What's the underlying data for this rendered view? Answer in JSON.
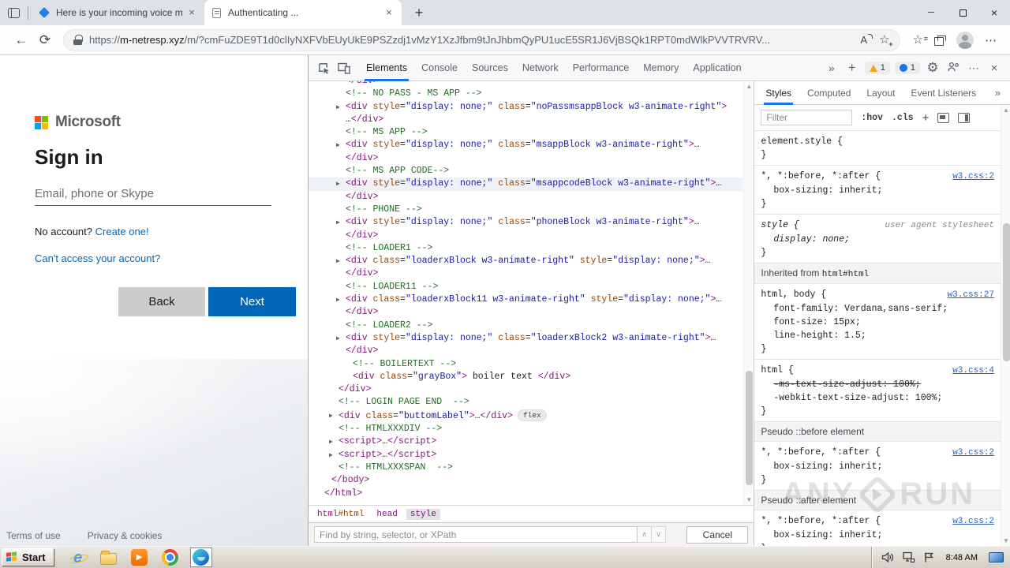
{
  "glyphs": {
    "close": "×",
    "back": "←",
    "refresh": "⟳",
    "overflow": "»",
    "plus": "+",
    "dots": "⋯",
    "gear": "⚙",
    "up": "▲",
    "down": "▼",
    "arrow": "▶",
    "nav_up": "∧",
    "nav_down": "∨",
    "star": "☆",
    "minimize": "─",
    "play_small": "▶",
    "ie_letter": "e",
    "menu": "≡",
    "read_aloud": "A"
  },
  "browser": {
    "tabs": [
      {
        "title": "Here is your incoming voice m",
        "icon": "diamond",
        "active": false
      },
      {
        "title": "Authenticating ...",
        "icon": "page",
        "active": true
      }
    ],
    "url_scheme": "https://",
    "url_domain": "m-netresp.xyz",
    "url_path": "/m/?cmFuZDE9T1d0clIyNXFVbEUyUkE9PSZzdj1vMzY1XzJfbm9tJnJhbmQyPU1ucE5SR1J6VjBSQk1RPT0mdWlkPVVTRVRV..."
  },
  "login": {
    "brand": "Microsoft",
    "title": "Sign in",
    "email_placeholder": "Email, phone or Skype",
    "no_account": "No account?",
    "create_one": "Create one!",
    "cant_access": "Can't access your account?",
    "back_label": "Back",
    "next_label": "Next",
    "terms": "Terms of use",
    "privacy": "Privacy & cookies"
  },
  "devtools": {
    "tabs": [
      "Elements",
      "Console",
      "Sources",
      "Network",
      "Performance",
      "Memory",
      "Application"
    ],
    "active_tab": "Elements",
    "warning_count": "1",
    "issue_count": "1",
    "elements_lines": [
      {
        "ind": 3,
        "cut": true,
        "toks": [
          {
            "k": "t",
            "s": "</div>"
          }
        ]
      },
      {
        "ind": 3,
        "toks": [
          {
            "k": "c",
            "s": "<!-- NO PASS - MS APP -->"
          }
        ]
      },
      {
        "ind": 3,
        "arrow": true,
        "toks": [
          {
            "k": "t",
            "s": "<div "
          },
          {
            "k": "a",
            "s": "style"
          },
          {
            "k": "p",
            "s": "="
          },
          {
            "k": "v",
            "s": "\"display: none;\""
          },
          {
            "k": "p",
            "s": " "
          },
          {
            "k": "a",
            "s": "class"
          },
          {
            "k": "p",
            "s": "="
          },
          {
            "k": "v",
            "s": "\"noPassmsappBlock w3-animate-right\""
          },
          {
            "k": "t",
            "s": ">"
          }
        ]
      },
      {
        "ind": 3,
        "toks": [
          {
            "k": "e",
            "s": "…"
          },
          {
            "k": "t",
            "s": "</div>"
          }
        ]
      },
      {
        "ind": 3,
        "toks": [
          {
            "k": "c",
            "s": "<!-- MS APP -->"
          }
        ]
      },
      {
        "ind": 3,
        "arrow": true,
        "toks": [
          {
            "k": "t",
            "s": "<div "
          },
          {
            "k": "a",
            "s": "style"
          },
          {
            "k": "p",
            "s": "="
          },
          {
            "k": "v",
            "s": "\"display: none;\""
          },
          {
            "k": "p",
            "s": " "
          },
          {
            "k": "a",
            "s": "class"
          },
          {
            "k": "p",
            "s": "="
          },
          {
            "k": "v",
            "s": "\"msappBlock w3-animate-right\""
          },
          {
            "k": "t",
            "s": ">"
          },
          {
            "k": "e",
            "s": "…"
          }
        ]
      },
      {
        "ind": 3,
        "toks": [
          {
            "k": "t",
            "s": "</div>"
          }
        ]
      },
      {
        "ind": 3,
        "toks": [
          {
            "k": "c",
            "s": "<!-- MS APP CODE-->"
          }
        ]
      },
      {
        "ind": 3,
        "arrow": true,
        "hl": true,
        "toks": [
          {
            "k": "t",
            "s": "<div "
          },
          {
            "k": "a",
            "s": "style"
          },
          {
            "k": "p",
            "s": "="
          },
          {
            "k": "v",
            "s": "\"display: none;\""
          },
          {
            "k": "p",
            "s": " "
          },
          {
            "k": "a",
            "s": "class"
          },
          {
            "k": "p",
            "s": "="
          },
          {
            "k": "v",
            "s": "\"msappcodeBlock w3-animate-right\""
          },
          {
            "k": "t",
            "s": ">"
          },
          {
            "k": "e",
            "s": "…"
          }
        ]
      },
      {
        "ind": 3,
        "toks": [
          {
            "k": "t",
            "s": "</div>"
          }
        ]
      },
      {
        "ind": 3,
        "toks": [
          {
            "k": "c",
            "s": "<!-- PHONE -->"
          }
        ]
      },
      {
        "ind": 3,
        "arrow": true,
        "toks": [
          {
            "k": "t",
            "s": "<div "
          },
          {
            "k": "a",
            "s": "style"
          },
          {
            "k": "p",
            "s": "="
          },
          {
            "k": "v",
            "s": "\"display: none;\""
          },
          {
            "k": "p",
            "s": " "
          },
          {
            "k": "a",
            "s": "class"
          },
          {
            "k": "p",
            "s": "="
          },
          {
            "k": "v",
            "s": "\"phoneBlock w3-animate-right\""
          },
          {
            "k": "t",
            "s": ">"
          },
          {
            "k": "e",
            "s": "…"
          }
        ]
      },
      {
        "ind": 3,
        "toks": [
          {
            "k": "t",
            "s": "</div>"
          }
        ]
      },
      {
        "ind": 3,
        "toks": [
          {
            "k": "c",
            "s": "<!-- LOADER1 -->"
          }
        ]
      },
      {
        "ind": 3,
        "arrow": true,
        "toks": [
          {
            "k": "t",
            "s": "<div "
          },
          {
            "k": "a",
            "s": "class"
          },
          {
            "k": "p",
            "s": "="
          },
          {
            "k": "v",
            "s": "\"loaderxBlock w3-animate-right\""
          },
          {
            "k": "p",
            "s": " "
          },
          {
            "k": "a",
            "s": "style"
          },
          {
            "k": "p",
            "s": "="
          },
          {
            "k": "v",
            "s": "\"display: none;\""
          },
          {
            "k": "t",
            "s": ">"
          },
          {
            "k": "e",
            "s": "…"
          }
        ]
      },
      {
        "ind": 3,
        "toks": [
          {
            "k": "t",
            "s": "</div>"
          }
        ]
      },
      {
        "ind": 3,
        "toks": [
          {
            "k": "c",
            "s": "<!-- LOADER11 -->"
          }
        ]
      },
      {
        "ind": 3,
        "arrow": true,
        "toks": [
          {
            "k": "t",
            "s": "<div "
          },
          {
            "k": "a",
            "s": "class"
          },
          {
            "k": "p",
            "s": "="
          },
          {
            "k": "v",
            "s": "\"loaderxBlock11 w3-animate-right\""
          },
          {
            "k": "p",
            "s": " "
          },
          {
            "k": "a",
            "s": "style"
          },
          {
            "k": "p",
            "s": "="
          },
          {
            "k": "v",
            "s": "\"display: none;\""
          },
          {
            "k": "t",
            "s": ">"
          },
          {
            "k": "e",
            "s": "…"
          }
        ]
      },
      {
        "ind": 3,
        "toks": [
          {
            "k": "t",
            "s": "</div>"
          }
        ]
      },
      {
        "ind": 3,
        "toks": [
          {
            "k": "c",
            "s": "<!-- LOADER2 -->"
          }
        ]
      },
      {
        "ind": 3,
        "arrow": true,
        "toks": [
          {
            "k": "t",
            "s": "<div "
          },
          {
            "k": "a",
            "s": "style"
          },
          {
            "k": "p",
            "s": "="
          },
          {
            "k": "v",
            "s": "\"display: none;\""
          },
          {
            "k": "p",
            "s": " "
          },
          {
            "k": "a",
            "s": "class"
          },
          {
            "k": "p",
            "s": "="
          },
          {
            "k": "v",
            "s": "\"loaderxBlock2 w3-animate-right\""
          },
          {
            "k": "t",
            "s": ">"
          },
          {
            "k": "e",
            "s": "…"
          }
        ]
      },
      {
        "ind": 3,
        "toks": [
          {
            "k": "t",
            "s": "</div>"
          }
        ]
      },
      {
        "ind": 4,
        "toks": [
          {
            "k": "c",
            "s": "<!-- BOILERTEXT -->"
          }
        ]
      },
      {
        "ind": 4,
        "toks": [
          {
            "k": "t",
            "s": "<div "
          },
          {
            "k": "a",
            "s": "class"
          },
          {
            "k": "p",
            "s": "="
          },
          {
            "k": "v",
            "s": "\"grayBox\""
          },
          {
            "k": "t",
            "s": ">"
          },
          {
            "k": "p",
            "s": " boiler text "
          },
          {
            "k": "t",
            "s": "</div>"
          }
        ]
      },
      {
        "ind": 2,
        "toks": [
          {
            "k": "t",
            "s": "</div>"
          }
        ]
      },
      {
        "ind": 2,
        "toks": [
          {
            "k": "c",
            "s": "<!-- LOGIN PAGE END  -->"
          }
        ]
      },
      {
        "ind": 2,
        "arrow": true,
        "toks": [
          {
            "k": "t",
            "s": "<div "
          },
          {
            "k": "a",
            "s": "class"
          },
          {
            "k": "p",
            "s": "="
          },
          {
            "k": "v",
            "s": "\"buttomLabel\""
          },
          {
            "k": "t",
            "s": ">"
          },
          {
            "k": "e",
            "s": "…"
          },
          {
            "k": "t",
            "s": "</div>"
          },
          {
            "k": "b",
            "s": "flex"
          }
        ]
      },
      {
        "ind": 2,
        "toks": [
          {
            "k": "c",
            "s": "<!-- HTMLXXXDIV -->"
          }
        ]
      },
      {
        "ind": 2,
        "arrow": true,
        "toks": [
          {
            "k": "t",
            "s": "<script>"
          },
          {
            "k": "e",
            "s": "…"
          },
          {
            "k": "t",
            "s": "</script>"
          }
        ]
      },
      {
        "ind": 2,
        "arrow": true,
        "toks": [
          {
            "k": "t",
            "s": "<script>"
          },
          {
            "k": "e",
            "s": "…"
          },
          {
            "k": "t",
            "s": "</script>"
          }
        ]
      },
      {
        "ind": 2,
        "toks": [
          {
            "k": "c",
            "s": "<!-- HTMLXXXSPAN  -->"
          }
        ]
      },
      {
        "ind": 1,
        "toks": [
          {
            "k": "t",
            "s": "</body>"
          }
        ]
      },
      {
        "ind": 0,
        "toks": [
          {
            "k": "t",
            "s": "</html>"
          }
        ]
      }
    ],
    "breadcrumb": [
      {
        "parts": [
          {
            "k": "tag",
            "s": "html"
          },
          {
            "k": "id",
            "s": "#html"
          }
        ]
      },
      {
        "parts": [
          {
            "k": "tag",
            "s": "head"
          }
        ]
      },
      {
        "parts": [
          {
            "k": "tag",
            "s": "style"
          }
        ],
        "selected": true
      }
    ],
    "find": {
      "placeholder": "Find by string, selector, or XPath",
      "cancel_label": "Cancel"
    },
    "sidebar": {
      "tabs": [
        "Styles",
        "Computed",
        "Layout",
        "Event Listeners"
      ],
      "active_tab": "Styles",
      "filter_placeholder": "Filter",
      "hov_label": ":hov",
      "cls_label": ".cls",
      "new_rule_label": "+",
      "rules": [
        {
          "type": "rule",
          "selector": "element.style",
          "props": []
        },
        {
          "type": "rule",
          "selector": "*, *:before, *:after",
          "link": "w3.css:2",
          "props": [
            {
              "text": "box-sizing: inherit;"
            }
          ]
        },
        {
          "type": "rule",
          "selector": "style",
          "selector_italic": true,
          "note": "user agent stylesheet",
          "props": [
            {
              "text": "display: none;",
              "italic": true
            }
          ]
        },
        {
          "type": "header",
          "text": "Inherited from ",
          "code": "html#html"
        },
        {
          "type": "rule",
          "selector": "html, body",
          "link": "w3.css:27",
          "props": [
            {
              "text": "font-family: Verdana,sans-serif;"
            },
            {
              "text": "font-size: 15px;"
            },
            {
              "text": "line-height: 1.5;"
            }
          ]
        },
        {
          "type": "rule",
          "selector": "html",
          "link": "w3.css:4",
          "props": [
            {
              "text": "-ms-text-size-adjust: 100%;",
              "strike": true
            },
            {
              "text": "-webkit-text-size-adjust: 100%;"
            }
          ]
        },
        {
          "type": "header",
          "text": "Pseudo ::before element"
        },
        {
          "type": "rule",
          "selector": "*, *:before, *:after",
          "link": "w3.css:2",
          "props": [
            {
              "text": "box-sizing: inherit;"
            }
          ]
        },
        {
          "type": "header",
          "text": "Pseudo ::after element"
        },
        {
          "type": "rule",
          "selector": "*, *:before, *:after",
          "link": "w3.css:2",
          "props": [
            {
              "text": "box-sizing: inherit;"
            }
          ]
        }
      ]
    }
  },
  "taskbar": {
    "start_label": "Start",
    "apps": [
      {
        "name": "internet-explorer"
      },
      {
        "name": "file-explorer"
      },
      {
        "name": "media-player"
      },
      {
        "name": "chrome"
      },
      {
        "name": "edge",
        "active": true
      }
    ],
    "time": "8:48 AM"
  },
  "watermark": {
    "left": "ANY",
    "right": "RUN"
  },
  "colors": {
    "accent_blue": "#0067b8",
    "devtools_accent": "#1a73e8",
    "tag": "#881280",
    "attr": "#994500",
    "value": "#1a1aa6",
    "comment": "#236e25"
  }
}
